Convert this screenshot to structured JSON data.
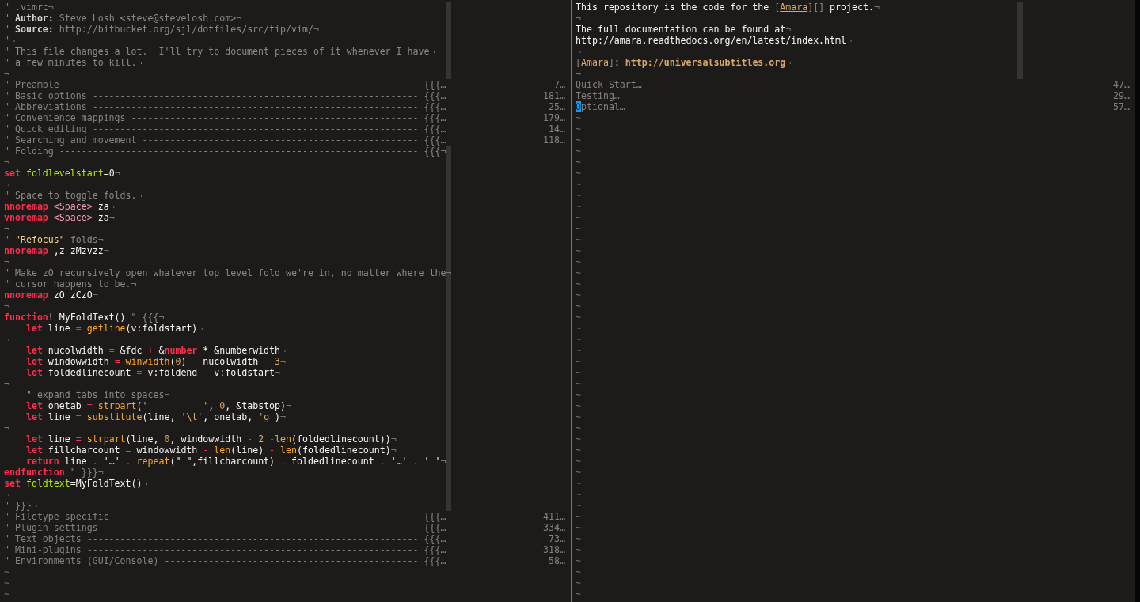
{
  "panes": [
    {
      "lines": [
        {
          "kind": "text",
          "segments": [
            {
              "kind": "comment",
              "text": "\" .vimrc"
            },
            {
              "kind": "eol",
              "text": "¬"
            }
          ]
        },
        {
          "kind": "text",
          "segments": [
            {
              "kind": "comment",
              "text": "\" "
            },
            {
              "kind": "bold",
              "text": "Author:"
            },
            {
              "kind": "comment",
              "text": " Steve Losh <steve@stevelosh.com>"
            },
            {
              "kind": "eol",
              "text": "¬"
            }
          ]
        },
        {
          "kind": "text",
          "segments": [
            {
              "kind": "comment",
              "text": "\" "
            },
            {
              "kind": "bold",
              "text": "Source:"
            },
            {
              "kind": "comment",
              "text": " http://bitbucket.org/sjl/dotfiles/src/tip/vim/"
            },
            {
              "kind": "eol",
              "text": "¬"
            }
          ]
        },
        {
          "kind": "text",
          "segments": [
            {
              "kind": "comment",
              "text": "\""
            },
            {
              "kind": "eol",
              "text": "¬"
            }
          ]
        },
        {
          "kind": "text",
          "segments": [
            {
              "kind": "comment",
              "text": "\" This file changes a lot.  I'll try to document pieces of it whenever I have"
            },
            {
              "kind": "eol",
              "text": "¬"
            }
          ]
        },
        {
          "kind": "text",
          "segments": [
            {
              "kind": "comment",
              "text": "\" a few minutes to kill."
            },
            {
              "kind": "eol",
              "text": "¬"
            }
          ]
        },
        {
          "kind": "text",
          "segments": [
            {
              "kind": "eol",
              "text": "¬"
            }
          ]
        },
        {
          "kind": "fold",
          "text": "\" Preamble ---------------------------------------------------------------- {{{…",
          "count": "7…"
        },
        {
          "kind": "fold",
          "text": "\" Basic options ----------------------------------------------------------- {{{…",
          "count": "181…"
        },
        {
          "kind": "fold",
          "text": "\" Abbreviations ----------------------------------------------------------- {{{…",
          "count": "25…"
        },
        {
          "kind": "fold",
          "text": "\" Convenience mappings ---------------------------------------------------- {{{…",
          "count": "179…"
        },
        {
          "kind": "fold",
          "text": "\" Quick editing ----------------------------------------------------------- {{{…",
          "count": "14…"
        },
        {
          "kind": "fold",
          "text": "\" Searching and movement -------------------------------------------------- {{{…",
          "count": "118…"
        },
        {
          "kind": "text",
          "segments": [
            {
              "kind": "comment",
              "text": "\" Folding ----------------------------------------------------------------- {{{"
            },
            {
              "kind": "eol",
              "text": "¬"
            }
          ]
        },
        {
          "kind": "text",
          "segments": [
            {
              "kind": "eol",
              "text": "¬"
            }
          ]
        },
        {
          "kind": "text",
          "segments": [
            {
              "kind": "keyword",
              "text": "set "
            },
            {
              "kind": "option",
              "text": "foldlevelstart"
            },
            {
              "kind": "plain",
              "text": "=0"
            },
            {
              "kind": "eol",
              "text": "¬"
            }
          ]
        },
        {
          "kind": "text",
          "segments": [
            {
              "kind": "eol",
              "text": "¬"
            }
          ]
        },
        {
          "kind": "text",
          "segments": [
            {
              "kind": "comment",
              "text": "\" Space to toggle folds."
            },
            {
              "kind": "eol",
              "text": "¬"
            }
          ]
        },
        {
          "kind": "text",
          "segments": [
            {
              "kind": "keyword",
              "text": "nnoremap "
            },
            {
              "kind": "special",
              "text": "<Space>"
            },
            {
              "kind": "plain",
              "text": " za"
            },
            {
              "kind": "eol",
              "text": "¬"
            }
          ]
        },
        {
          "kind": "text",
          "segments": [
            {
              "kind": "keyword",
              "text": "vnoremap "
            },
            {
              "kind": "special",
              "text": "<Space>"
            },
            {
              "kind": "plain",
              "text": " za"
            },
            {
              "kind": "eol",
              "text": "¬"
            }
          ]
        },
        {
          "kind": "text",
          "segments": [
            {
              "kind": "eol",
              "text": "¬"
            }
          ]
        },
        {
          "kind": "text",
          "segments": [
            {
              "kind": "comment",
              "text": "\" "
            },
            {
              "kind": "quote",
              "text": "\"Refocus\""
            },
            {
              "kind": "comment",
              "text": " folds"
            },
            {
              "kind": "eol",
              "text": "¬"
            }
          ]
        },
        {
          "kind": "text",
          "segments": [
            {
              "kind": "keyword",
              "text": "nnoremap"
            },
            {
              "kind": "plain",
              "text": " ,z zMzvzz"
            },
            {
              "kind": "eol",
              "text": "¬"
            }
          ]
        },
        {
          "kind": "text",
          "segments": [
            {
              "kind": "eol",
              "text": "¬"
            }
          ]
        },
        {
          "kind": "text",
          "segments": [
            {
              "kind": "comment",
              "text": "\" Make zO recursively open whatever top level fold we're in, no matter where the"
            },
            {
              "kind": "eol",
              "text": "¬"
            }
          ]
        },
        {
          "kind": "text",
          "segments": [
            {
              "kind": "comment",
              "text": "\" cursor happens to be."
            },
            {
              "kind": "eol",
              "text": "¬"
            }
          ]
        },
        {
          "kind": "text",
          "segments": [
            {
              "kind": "keyword",
              "text": "nnoremap"
            },
            {
              "kind": "plain",
              "text": " zO zCzO"
            },
            {
              "kind": "eol",
              "text": "¬"
            }
          ]
        },
        {
          "kind": "text",
          "segments": [
            {
              "kind": "eol",
              "text": "¬"
            }
          ]
        },
        {
          "kind": "text",
          "segments": [
            {
              "kind": "keyword",
              "text": "function"
            },
            {
              "kind": "plain",
              "text": "! MyFoldText() "
            },
            {
              "kind": "comment",
              "text": "\" {{{"
            },
            {
              "kind": "eol",
              "text": "¬"
            }
          ]
        },
        {
          "kind": "text",
          "segments": [
            {
              "kind": "keyword",
              "text": "    let"
            },
            {
              "kind": "plain",
              "text": " line "
            },
            {
              "kind": "operator",
              "text": "= "
            },
            {
              "kind": "function",
              "text": "getline"
            },
            {
              "kind": "plain",
              "text": "(v:foldstart)"
            },
            {
              "kind": "eol",
              "text": "¬"
            }
          ]
        },
        {
          "kind": "text",
          "segments": [
            {
              "kind": "eol",
              "text": "¬"
            }
          ]
        },
        {
          "kind": "text",
          "segments": [
            {
              "kind": "keyword",
              "text": "    let"
            },
            {
              "kind": "plain",
              "text": " nucolwidth "
            },
            {
              "kind": "operator",
              "text": "="
            },
            {
              "kind": "plain",
              "text": " &fdc "
            },
            {
              "kind": "operator",
              "text": "+"
            },
            {
              "kind": "plain",
              "text": " &"
            },
            {
              "kind": "keyword",
              "text": "number"
            },
            {
              "kind": "plain",
              "text": " * &numberwidth"
            },
            {
              "kind": "eol",
              "text": "¬"
            }
          ]
        },
        {
          "kind": "text",
          "segments": [
            {
              "kind": "keyword",
              "text": "    let"
            },
            {
              "kind": "plain",
              "text": " windowwidth "
            },
            {
              "kind": "operator",
              "text": "= "
            },
            {
              "kind": "function",
              "text": "winwidth"
            },
            {
              "kind": "plain",
              "text": "("
            },
            {
              "kind": "number",
              "text": "0"
            },
            {
              "kind": "plain",
              "text": ") "
            },
            {
              "kind": "operator",
              "text": "-"
            },
            {
              "kind": "plain",
              "text": " nucolwidth "
            },
            {
              "kind": "operator",
              "text": "- "
            },
            {
              "kind": "number",
              "text": "3"
            },
            {
              "kind": "eol",
              "text": "¬"
            }
          ]
        },
        {
          "kind": "text",
          "segments": [
            {
              "kind": "keyword",
              "text": "    let"
            },
            {
              "kind": "plain",
              "text": " foldedlinecount "
            },
            {
              "kind": "operator",
              "text": "="
            },
            {
              "kind": "plain",
              "text": " v:foldend "
            },
            {
              "kind": "operator",
              "text": "-"
            },
            {
              "kind": "plain",
              "text": " v:foldstart"
            },
            {
              "kind": "eol",
              "text": "¬"
            }
          ]
        },
        {
          "kind": "text",
          "segments": [
            {
              "kind": "eol",
              "text": "¬"
            }
          ]
        },
        {
          "kind": "text",
          "segments": [
            {
              "kind": "comment",
              "text": "    \" expand tabs into spaces"
            },
            {
              "kind": "eol",
              "text": "¬"
            }
          ]
        },
        {
          "kind": "text",
          "segments": [
            {
              "kind": "keyword",
              "text": "    let"
            },
            {
              "kind": "plain",
              "text": " onetab "
            },
            {
              "kind": "operator",
              "text": "= "
            },
            {
              "kind": "function",
              "text": "strpart"
            },
            {
              "kind": "plain",
              "text": "("
            },
            {
              "kind": "string",
              "text": "'          '"
            },
            {
              "kind": "plain",
              "text": ", "
            },
            {
              "kind": "number",
              "text": "0"
            },
            {
              "kind": "plain",
              "text": ", &tabstop)"
            },
            {
              "kind": "eol",
              "text": "¬"
            }
          ]
        },
        {
          "kind": "text",
          "segments": [
            {
              "kind": "keyword",
              "text": "    let"
            },
            {
              "kind": "plain",
              "text": " line "
            },
            {
              "kind": "operator",
              "text": "= "
            },
            {
              "kind": "function",
              "text": "substitute"
            },
            {
              "kind": "plain",
              "text": "(line, "
            },
            {
              "kind": "string",
              "text": "'\\t'"
            },
            {
              "kind": "plain",
              "text": ", onetab, "
            },
            {
              "kind": "string",
              "text": "'g'"
            },
            {
              "kind": "plain",
              "text": ")"
            },
            {
              "kind": "eol",
              "text": "¬"
            }
          ]
        },
        {
          "kind": "text",
          "segments": [
            {
              "kind": "eol",
              "text": "¬"
            }
          ]
        },
        {
          "kind": "text",
          "segments": [
            {
              "kind": "keyword",
              "text": "    let"
            },
            {
              "kind": "plain",
              "text": " line "
            },
            {
              "kind": "operator",
              "text": "= "
            },
            {
              "kind": "function",
              "text": "strpart"
            },
            {
              "kind": "plain",
              "text": "(line, "
            },
            {
              "kind": "number",
              "text": "0"
            },
            {
              "kind": "plain",
              "text": ", windowwidth "
            },
            {
              "kind": "operator",
              "text": "- "
            },
            {
              "kind": "number",
              "text": "2 "
            },
            {
              "kind": "operator",
              "text": "-"
            },
            {
              "kind": "function",
              "text": "len"
            },
            {
              "kind": "plain",
              "text": "(foldedlinecount))"
            },
            {
              "kind": "eol",
              "text": "¬"
            }
          ]
        },
        {
          "kind": "text",
          "segments": [
            {
              "kind": "keyword",
              "text": "    let"
            },
            {
              "kind": "plain",
              "text": " fillcharcount "
            },
            {
              "kind": "operator",
              "text": "="
            },
            {
              "kind": "plain",
              "text": " windowwidth "
            },
            {
              "kind": "operator",
              "text": "- "
            },
            {
              "kind": "function",
              "text": "len"
            },
            {
              "kind": "plain",
              "text": "(line) "
            },
            {
              "kind": "operator",
              "text": "- "
            },
            {
              "kind": "function",
              "text": "len"
            },
            {
              "kind": "plain",
              "text": "(foldedlinecount)"
            },
            {
              "kind": "eol",
              "text": "¬"
            }
          ]
        },
        {
          "kind": "text",
          "segments": [
            {
              "kind": "keyword",
              "text": "    return"
            },
            {
              "kind": "plain",
              "text": " line "
            },
            {
              "kind": "operator",
              "text": "."
            },
            {
              "kind": "plain",
              "text": " '…' "
            },
            {
              "kind": "operator",
              "text": ". "
            },
            {
              "kind": "function",
              "text": "repeat"
            },
            {
              "kind": "plain",
              "text": "(\" \",fillcharcount) "
            },
            {
              "kind": "operator",
              "text": "."
            },
            {
              "kind": "plain",
              "text": " foldedlinecount "
            },
            {
              "kind": "operator",
              "text": "."
            },
            {
              "kind": "plain",
              "text": " '…' "
            },
            {
              "kind": "operator",
              "text": "."
            },
            {
              "kind": "plain",
              "text": " ' '"
            },
            {
              "kind": "eol",
              "text": "¬"
            }
          ]
        },
        {
          "kind": "text",
          "segments": [
            {
              "kind": "keyword",
              "text": "endfunction "
            },
            {
              "kind": "comment",
              "text": "\" }}}"
            },
            {
              "kind": "eol",
              "text": "¬"
            }
          ]
        },
        {
          "kind": "text",
          "segments": [
            {
              "kind": "keyword",
              "text": "set "
            },
            {
              "kind": "option",
              "text": "foldtext"
            },
            {
              "kind": "plain",
              "text": "=MyFoldText()"
            },
            {
              "kind": "eol",
              "text": "¬"
            }
          ]
        },
        {
          "kind": "text",
          "segments": [
            {
              "kind": "eol",
              "text": "¬"
            }
          ]
        },
        {
          "kind": "text",
          "segments": [
            {
              "kind": "comment",
              "text": "\" }}}"
            },
            {
              "kind": "eol",
              "text": "¬"
            }
          ]
        },
        {
          "kind": "fold",
          "text": "\" Filetype-specific ------------------------------------------------------- {{{…",
          "count": "411…"
        },
        {
          "kind": "fold",
          "text": "\" Plugin settings --------------------------------------------------------- {{{…",
          "count": "334…"
        },
        {
          "kind": "fold",
          "text": "\" Text objects ------------------------------------------------------------ {{{…",
          "count": "73…"
        },
        {
          "kind": "fold",
          "text": "\" Mini-plugins ------------------------------------------------------------ {{{…",
          "count": "318…"
        },
        {
          "kind": "fold",
          "text": "\" Environments (GUI/Console) ---------------------------------------------- {{{…",
          "count": "58…"
        },
        {
          "kind": "tilde",
          "text": "~"
        },
        {
          "kind": "tilde",
          "text": "~"
        },
        {
          "kind": "tilde",
          "text": "~"
        }
      ]
    },
    {
      "lines": [
        {
          "kind": "text",
          "segments": [
            {
              "kind": "plain",
              "text": "This repository is the code for the "
            },
            {
              "kind": "comment",
              "text": "["
            },
            {
              "kind": "link",
              "text": "Amara"
            },
            {
              "kind": "comment",
              "text": "][]"
            },
            {
              "kind": "plain",
              "text": " project."
            },
            {
              "kind": "eol",
              "text": "¬"
            }
          ]
        },
        {
          "kind": "text",
          "segments": [
            {
              "kind": "eol",
              "text": "¬"
            }
          ]
        },
        {
          "kind": "text",
          "segments": [
            {
              "kind": "plain",
              "text": "The full documentation can be found at"
            },
            {
              "kind": "eol",
              "text": "¬"
            }
          ]
        },
        {
          "kind": "text",
          "segments": [
            {
              "kind": "plain",
              "text": "http://amara.readthedocs.org/en/latest/index.html"
            },
            {
              "kind": "eol",
              "text": "¬"
            }
          ]
        },
        {
          "kind": "text",
          "segments": [
            {
              "kind": "eol",
              "text": "¬"
            }
          ]
        },
        {
          "kind": "text",
          "segments": [
            {
              "kind": "comment",
              "text": "["
            },
            {
              "kind": "label",
              "text": "Amara"
            },
            {
              "kind": "comment",
              "text": "]"
            },
            {
              "kind": "plain",
              "text": ": "
            },
            {
              "kind": "url",
              "text": "http://universalsubtitles.org"
            },
            {
              "kind": "eol",
              "text": "¬"
            }
          ]
        },
        {
          "kind": "text",
          "segments": [
            {
              "kind": "eol",
              "text": "¬"
            }
          ]
        },
        {
          "kind": "fold",
          "text": "Quick Start…",
          "count": "47…",
          "cursor": false
        },
        {
          "kind": "fold",
          "text": "Testing…",
          "count": "29…",
          "cursor": false
        },
        {
          "kind": "fold",
          "text": "Optional…",
          "count": "57…",
          "cursor": true
        },
        {
          "kind": "tilde",
          "text": "~"
        },
        {
          "kind": "tilde",
          "text": "~"
        },
        {
          "kind": "tilde",
          "text": "~"
        },
        {
          "kind": "tilde",
          "text": "~"
        },
        {
          "kind": "tilde",
          "text": "~"
        },
        {
          "kind": "tilde",
          "text": "~"
        },
        {
          "kind": "tilde",
          "text": "~"
        },
        {
          "kind": "tilde",
          "text": "~"
        },
        {
          "kind": "tilde",
          "text": "~"
        },
        {
          "kind": "tilde",
          "text": "~"
        },
        {
          "kind": "tilde",
          "text": "~"
        },
        {
          "kind": "tilde",
          "text": "~"
        },
        {
          "kind": "tilde",
          "text": "~"
        },
        {
          "kind": "tilde",
          "text": "~"
        },
        {
          "kind": "tilde",
          "text": "~"
        },
        {
          "kind": "tilde",
          "text": "~"
        },
        {
          "kind": "tilde",
          "text": "~"
        },
        {
          "kind": "tilde",
          "text": "~"
        },
        {
          "kind": "tilde",
          "text": "~"
        },
        {
          "kind": "tilde",
          "text": "~"
        },
        {
          "kind": "tilde",
          "text": "~"
        },
        {
          "kind": "tilde",
          "text": "~"
        },
        {
          "kind": "tilde",
          "text": "~"
        },
        {
          "kind": "tilde",
          "text": "~"
        },
        {
          "kind": "tilde",
          "text": "~"
        },
        {
          "kind": "tilde",
          "text": "~"
        },
        {
          "kind": "tilde",
          "text": "~"
        },
        {
          "kind": "tilde",
          "text": "~"
        },
        {
          "kind": "tilde",
          "text": "~"
        },
        {
          "kind": "tilde",
          "text": "~"
        },
        {
          "kind": "tilde",
          "text": "~"
        },
        {
          "kind": "tilde",
          "text": "~"
        },
        {
          "kind": "tilde",
          "text": "~"
        },
        {
          "kind": "tilde",
          "text": "~"
        },
        {
          "kind": "tilde",
          "text": "~"
        },
        {
          "kind": "tilde",
          "text": "~"
        },
        {
          "kind": "tilde",
          "text": "~"
        },
        {
          "kind": "tilde",
          "text": "~"
        },
        {
          "kind": "tilde",
          "text": "~"
        },
        {
          "kind": "tilde",
          "text": "~"
        },
        {
          "kind": "tilde",
          "text": "~"
        },
        {
          "kind": "tilde",
          "text": "~"
        },
        {
          "kind": "tilde",
          "text": "~"
        },
        {
          "kind": "tilde",
          "text": "~"
        }
      ]
    }
  ]
}
